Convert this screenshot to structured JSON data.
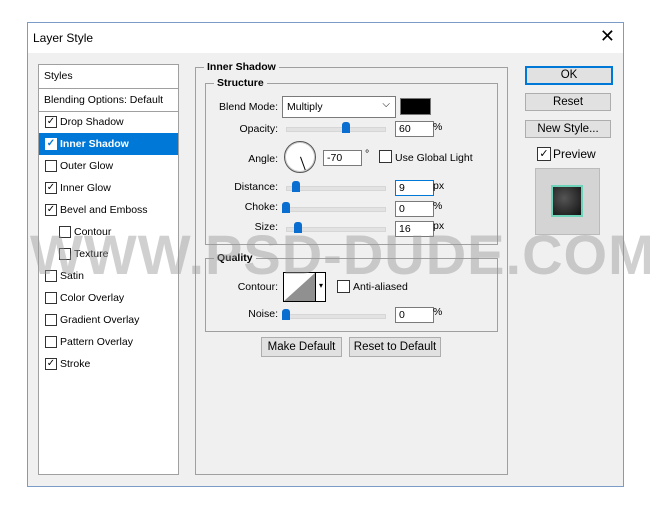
{
  "window": {
    "title": "Layer Style",
    "close_icon": "close-icon"
  },
  "sidebar": {
    "header": "Styles",
    "blending": "Blending Options: Default",
    "items": [
      {
        "label": "Drop Shadow",
        "checked": true,
        "indent": false
      },
      {
        "label": "Inner Shadow",
        "checked": true,
        "indent": false,
        "selected": true
      },
      {
        "label": "Outer Glow",
        "checked": false,
        "indent": false
      },
      {
        "label": "Inner Glow",
        "checked": true,
        "indent": false
      },
      {
        "label": "Bevel and Emboss",
        "checked": true,
        "indent": false
      },
      {
        "label": "Contour",
        "checked": false,
        "indent": true
      },
      {
        "label": "Texture",
        "checked": false,
        "indent": true
      },
      {
        "label": "Satin",
        "checked": false,
        "indent": false
      },
      {
        "label": "Color Overlay",
        "checked": false,
        "indent": false
      },
      {
        "label": "Gradient Overlay",
        "checked": false,
        "indent": false
      },
      {
        "label": "Pattern Overlay",
        "checked": false,
        "indent": false
      },
      {
        "label": "Stroke",
        "checked": true,
        "indent": false
      }
    ]
  },
  "panel": {
    "title": "Inner Shadow",
    "structure": {
      "title": "Structure",
      "blend_label": "Blend Mode:",
      "blend_value": "Multiply",
      "color": "#000000",
      "opacity_label": "Opacity:",
      "opacity": "60",
      "opacity_unit": "%",
      "angle_label": "Angle:",
      "angle": "-70",
      "angle_unit": "°",
      "global_light": "Use Global Light",
      "distance_label": "Distance:",
      "distance": "9",
      "distance_unit": "px",
      "choke_label": "Choke:",
      "choke": "0",
      "choke_unit": "%",
      "size_label": "Size:",
      "size": "16",
      "size_unit": "px"
    },
    "quality": {
      "title": "Quality",
      "contour_label": "Contour:",
      "anti_aliased": "Anti-aliased",
      "noise_label": "Noise:",
      "noise": "0",
      "noise_unit": "%"
    },
    "make_default": "Make Default",
    "reset_default": "Reset to Default"
  },
  "buttons": {
    "ok": "OK",
    "reset": "Reset",
    "new_style": "New Style...",
    "preview": "Preview"
  },
  "watermark": "WWW.PSD-DUDE.COM",
  "colors": {
    "accent": "#0078d7",
    "slider": "#0a6ed1"
  }
}
